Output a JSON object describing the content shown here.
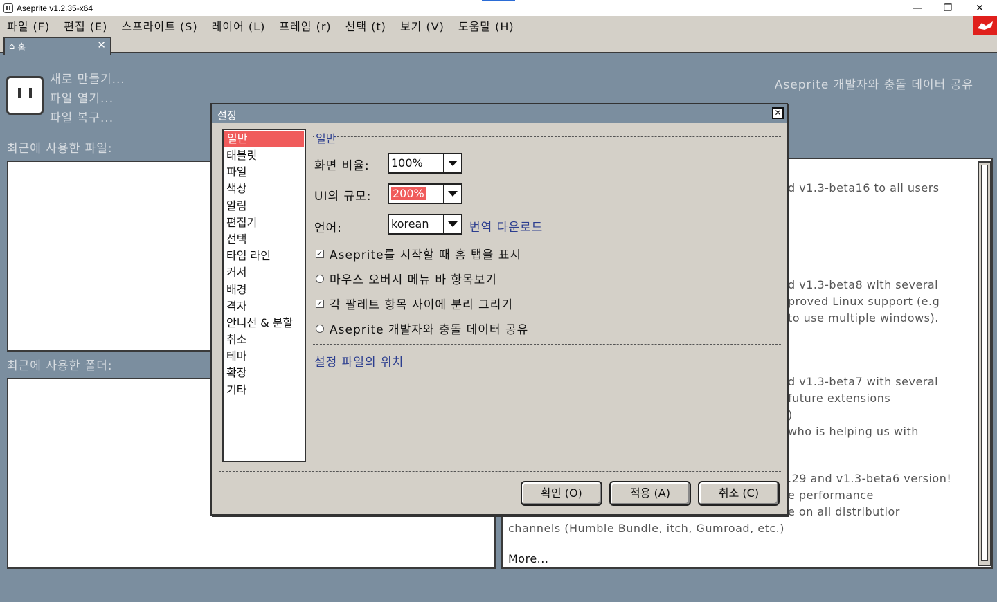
{
  "window": {
    "title": "Aseprite v1.2.35-x64"
  },
  "menu": [
    "파일 (F)",
    "편집 (E)",
    "스프라이트 (S)",
    "레이어 (L)",
    "프레임 (r)",
    "선택 (t)",
    "보기 (V)",
    "도움말 (H)"
  ],
  "tab": {
    "label": "홈"
  },
  "home": {
    "new_file": "새로 만들기...",
    "open_file": "파일 열기...",
    "recover": "파일 복구...",
    "share_data": "Aseprite 개발자와 충돌 데이터 공유",
    "recent_files": "최근에 사용한 파일:",
    "recent_folders": "최근에 사용한 폴더:"
  },
  "news": {
    "lines": [
      "d v1.3-beta16 to all users",
      "d v1.3-beta8 with several",
      "proved Linux support (e.g",
      " to use multiple windows).",
      "d v1.3-beta7 with several",
      " future extensions",
      ")",
      " who is helping us with",
      ".29 and v1.3-beta6 version!",
      "e performance",
      "e on all distributior",
      "channels (Humble Bundle, itch, Gumroad, etc.)"
    ],
    "more": "More..."
  },
  "dialog": {
    "title": "설정",
    "categories": [
      "일반",
      "태블릿",
      "파일",
      "색상",
      "알림",
      "편집기",
      "선택",
      "타임 라인",
      "커서",
      "배경",
      "격자",
      "안니선 & 분할",
      "취소",
      "테마",
      "확장",
      "기타"
    ],
    "selected_category": "일반",
    "section": "일반",
    "screen_scale_label": "화면 비율:",
    "screen_scale_value": "100%",
    "ui_scale_label": "UI의 규모:",
    "ui_scale_value": "200%",
    "language_label": "언어:",
    "language_value": "korean",
    "download_translation": "번역 다운로드",
    "options": [
      {
        "label": "Aseprite를 시작할 때 홈 탭을 표시",
        "checked": true,
        "kind": "check"
      },
      {
        "label": "마우스 오버시 메뉴 바 항목보기",
        "checked": false,
        "kind": "radio"
      },
      {
        "label": "각 팔레트 항목 사이에 분리 그리기",
        "checked": true,
        "kind": "check"
      },
      {
        "label": "Aseprite 개발자와 충돌 데이터 공유",
        "checked": false,
        "kind": "radio"
      }
    ],
    "settings_location": "설정 파일의 위치",
    "ok": "확인 (O)",
    "apply": "적용 (A)",
    "cancel": "취소 (C)"
  }
}
